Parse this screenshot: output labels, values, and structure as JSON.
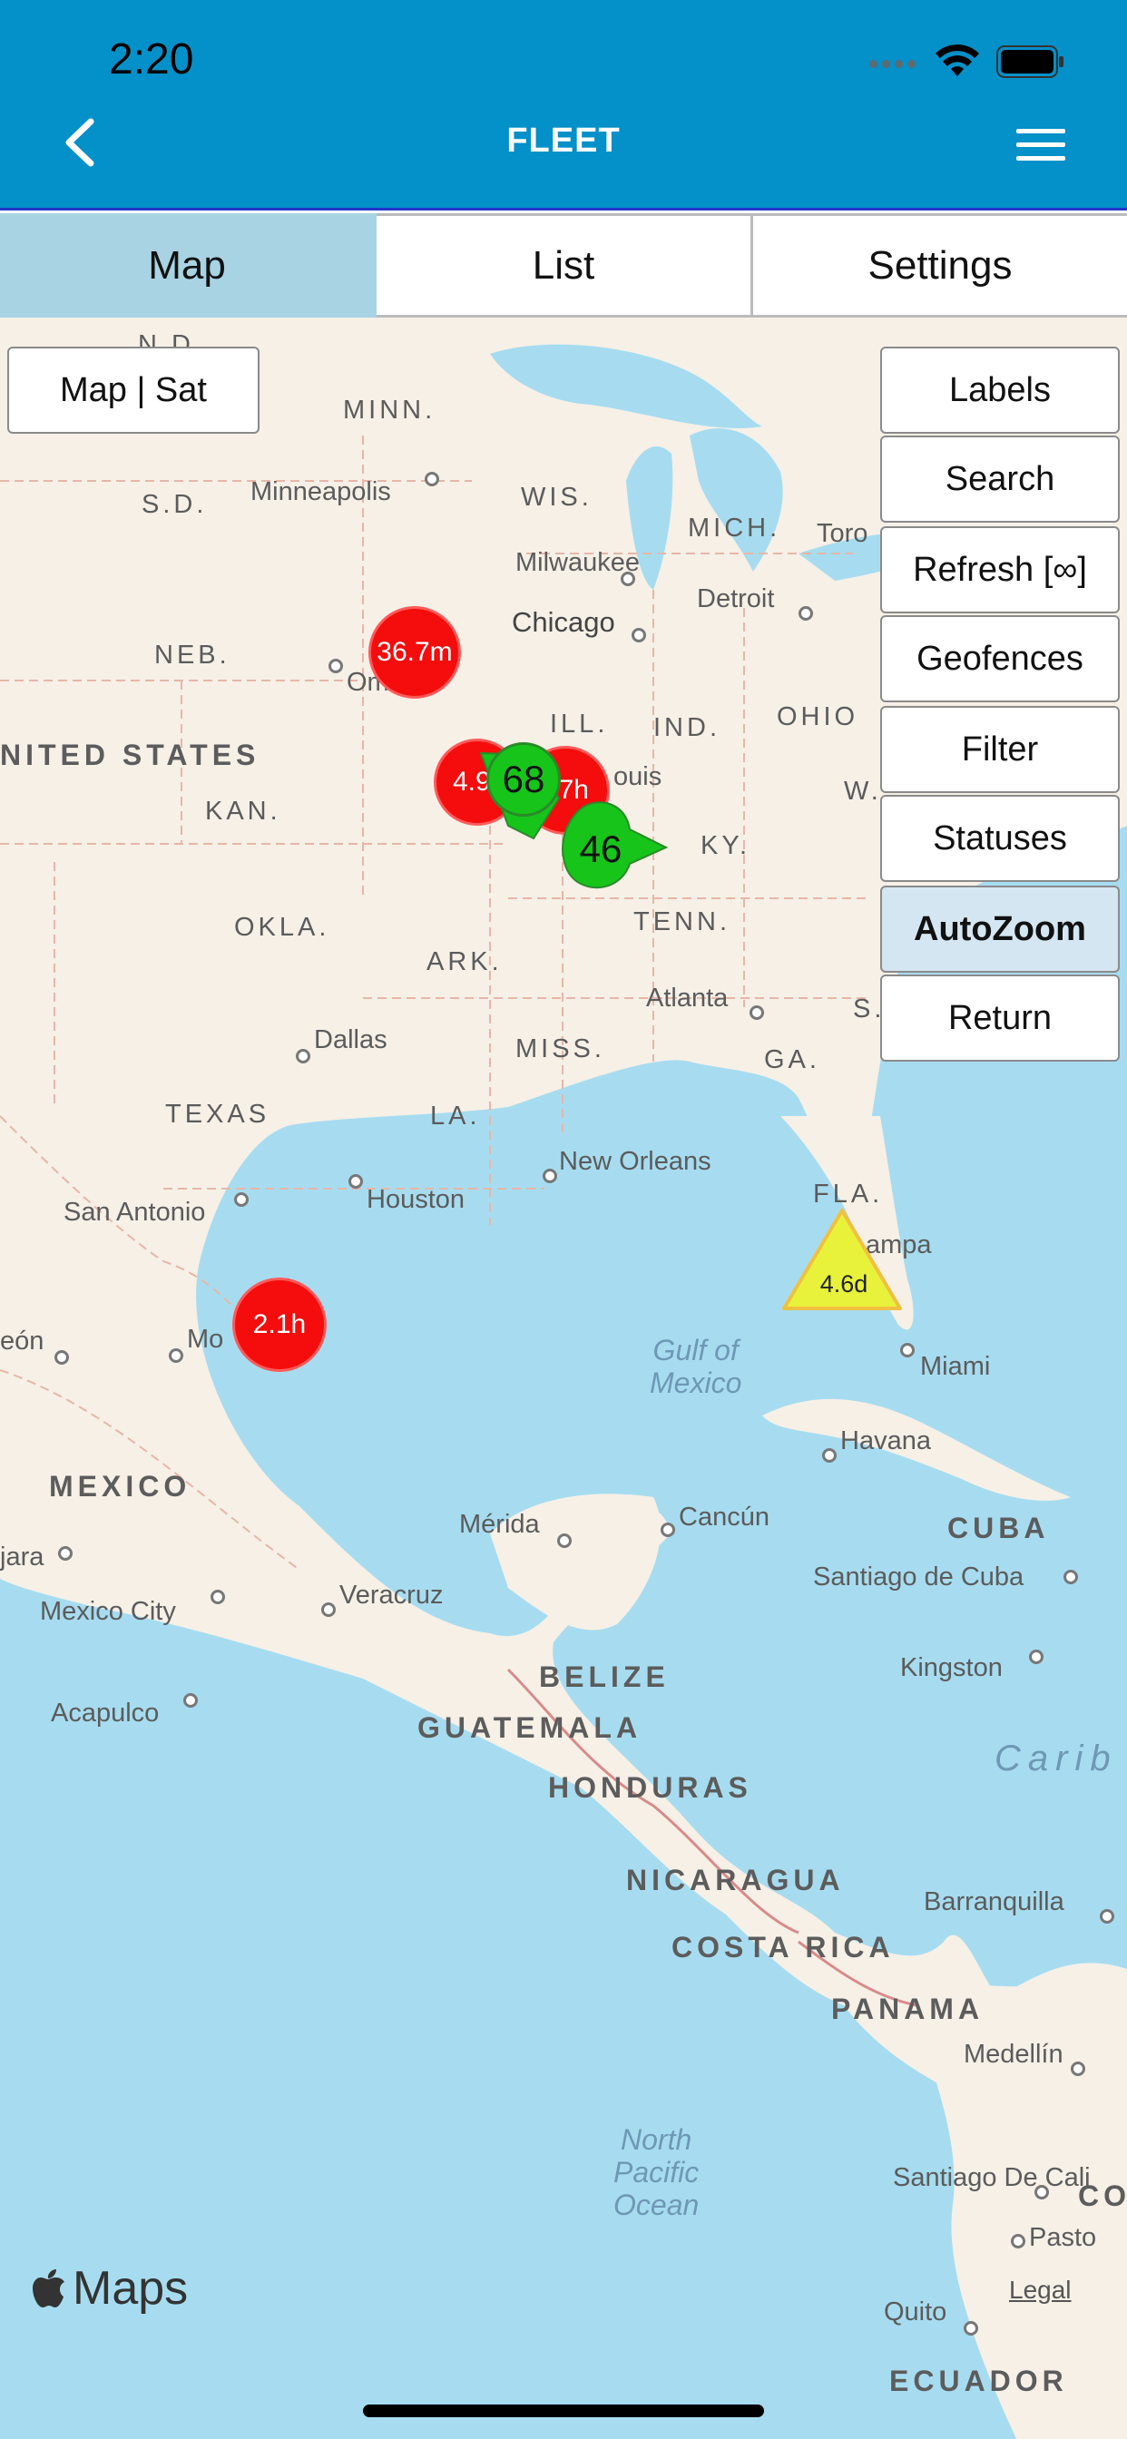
{
  "status_bar": {
    "time": "2:20"
  },
  "header": {
    "title": "FLEET"
  },
  "tabs": [
    {
      "label": "Map",
      "active": true
    },
    {
      "label": "List",
      "active": false
    },
    {
      "label": "Settings",
      "active": false
    }
  ],
  "map_controls": {
    "map_sat": "Map | Sat",
    "buttons": [
      {
        "label": "Labels"
      },
      {
        "label": "Search"
      },
      {
        "label": "Refresh  [∞]"
      },
      {
        "label": "Geofences"
      },
      {
        "label": "Filter"
      },
      {
        "label": "Statuses"
      },
      {
        "label": "AutoZoom",
        "active": true
      },
      {
        "label": "Return"
      }
    ]
  },
  "map_labels": {
    "states": [
      "N.D.",
      "MINN.",
      "S.D.",
      "WIS.",
      "MICH.",
      "NEB.",
      "ILL.",
      "IND.",
      "OHIO",
      "KAN.",
      "KY.",
      "W.",
      "OKLA.",
      "ARK.",
      "TENN.",
      "MISS.",
      "S.",
      "GA.",
      "TEXAS",
      "LA.",
      "FLA."
    ],
    "countries": [
      "NITED STATES",
      "MEXICO",
      "CUBA",
      "BELIZE",
      "GUATEMALA",
      "HONDURAS",
      "NICARAGUA",
      "COSTA RICA",
      "PANAMA",
      "ECUADOR",
      "CO"
    ],
    "cities": [
      "Minneapolis",
      "Milwaukee",
      "Toro",
      "Detroit",
      "Chicago",
      "Om",
      "ouis",
      "Atlanta",
      "Dallas",
      "New Orleans",
      "Houston",
      "San Antonio",
      "Mo",
      "eón",
      "Miami",
      "ampa",
      "Havana",
      "Mérida",
      "Cancún",
      "jara",
      "Mexico City",
      "Veracruz",
      "Santiago de Cuba",
      "Kingston",
      "Acapulco",
      "Barranquilla",
      "Medellín",
      "Santiago De Cali",
      "Pasto",
      "Quito"
    ],
    "water": {
      "gulf": "Gulf of Mexico",
      "pacific": "North Pacific Ocean",
      "carib": "Carib"
    }
  },
  "markers": [
    {
      "label": "36.7m",
      "color": "red"
    },
    {
      "label": "4.9",
      "color": "red"
    },
    {
      "label": "7h",
      "color": "red"
    },
    {
      "label": "68",
      "color": "green"
    },
    {
      "label": "46",
      "color": "green"
    },
    {
      "label": "4.6d",
      "color": "yellow"
    },
    {
      "label": "2.1h",
      "color": "red"
    }
  ],
  "attribution": {
    "maps": "Maps",
    "legal": "Legal"
  },
  "colors": {
    "header": "#0490c8",
    "tab_active": "#a8d3e3",
    "water": "#a7dcf0",
    "land": "#f6f0e7",
    "marker_red": "#f50c0c",
    "marker_green": "#16c41a",
    "marker_yellow": "#e8f23a"
  }
}
